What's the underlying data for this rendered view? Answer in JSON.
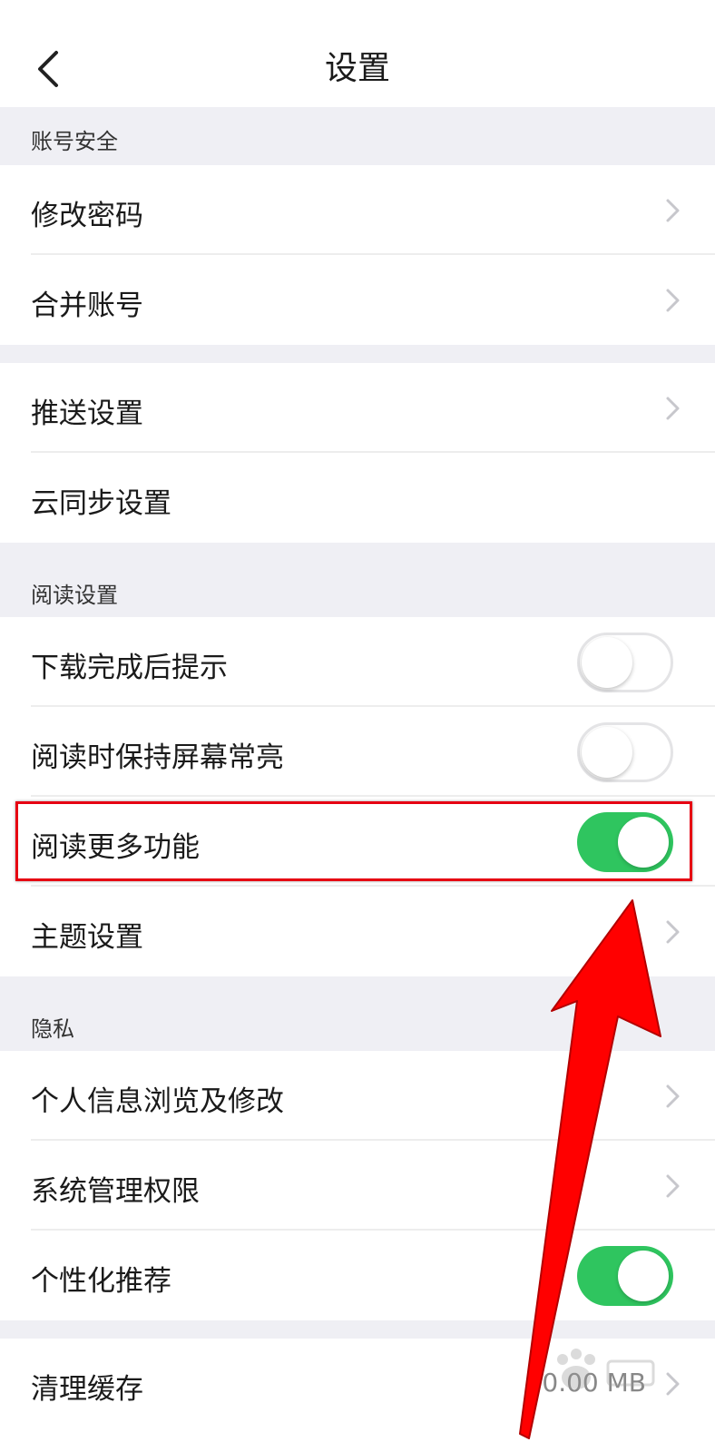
{
  "header": {
    "title": "设置",
    "back_icon": "chevron-left-icon"
  },
  "sections": {
    "account": {
      "title": "账号安全"
    },
    "reading": {
      "title": "阅读设置"
    },
    "privacy": {
      "title": "隐私"
    }
  },
  "rows": {
    "change_password": {
      "label": "修改密码",
      "icon": "chevron-right-icon"
    },
    "merge_account": {
      "label": "合并账号",
      "icon": "chevron-right-icon"
    },
    "push_settings": {
      "label": "推送设置",
      "icon": "chevron-right-icon"
    },
    "cloud_sync": {
      "label": "云同步设置"
    },
    "download_notice": {
      "label": "下载完成后提示",
      "toggle": "off"
    },
    "keep_screen_on": {
      "label": "阅读时保持屏幕常亮",
      "toggle": "off"
    },
    "more_features": {
      "label": "阅读更多功能",
      "toggle": "on"
    },
    "theme_settings": {
      "label": "主题设置",
      "icon": "chevron-right-icon"
    },
    "personal_info": {
      "label": "个人信息浏览及修改",
      "icon": "chevron-right-icon"
    },
    "system_permissions": {
      "label": "系统管理权限",
      "icon": "chevron-right-icon"
    },
    "personalized_recommend": {
      "label": "个性化推荐",
      "toggle": "on"
    },
    "clear_cache": {
      "label": "清理缓存",
      "value": "0.00 MB",
      "icon": "chevron-right-icon"
    }
  },
  "colors": {
    "toggle_on": "#2fc55f",
    "highlight_box": "#e60012",
    "arrow": "#ff0000",
    "background": "#efeff4"
  },
  "annotations": {
    "highlight": "red-box",
    "pointer": "red-arrow-icon",
    "watermark": "baidu-watermark-icon"
  }
}
